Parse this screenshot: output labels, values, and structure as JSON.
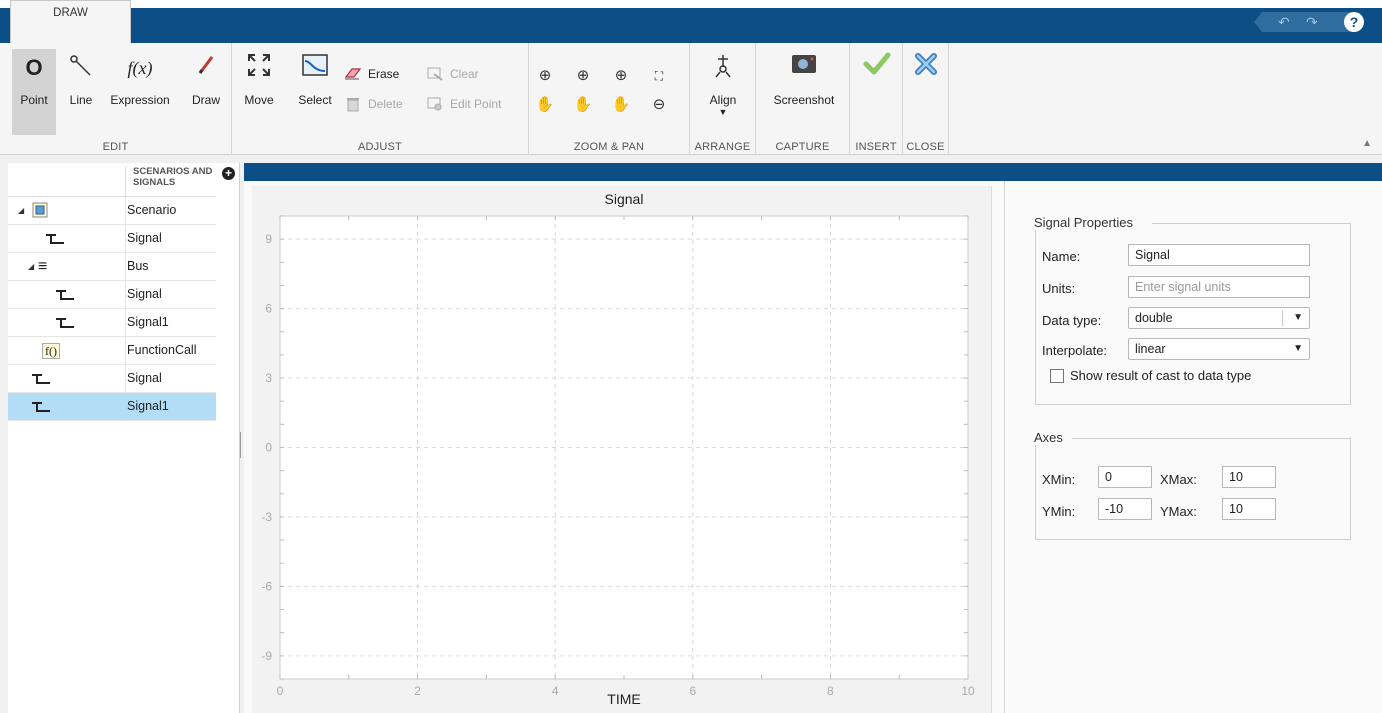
{
  "app": {
    "tab": "DRAW",
    "quick_access": {
      "undo": "undo-icon",
      "redo": "redo-icon",
      "help": "?"
    }
  },
  "toolstrip": {
    "edit": {
      "label": "EDIT",
      "point": "Point",
      "line": "Line",
      "expression": "Expression",
      "expression_glyph": "f(x)",
      "draw": "Draw"
    },
    "adjust": {
      "label": "ADJUST",
      "move": "Move",
      "select": "Select",
      "erase": "Erase",
      "clear": "Clear",
      "delete": "Delete",
      "edit_point": "Edit Point"
    },
    "zoom_pan": {
      "label": "ZOOM & PAN"
    },
    "arrange": {
      "label": "ARRANGE",
      "align": "Align"
    },
    "capture": {
      "label": "CAPTURE",
      "screenshot": "Screenshot"
    },
    "insert": {
      "label": "INSERT"
    },
    "close": {
      "label": "CLOSE"
    }
  },
  "tree": {
    "header": "SCENARIOS AND SIGNALS",
    "add_symbol": "+",
    "rows": [
      {
        "name": "Scenario",
        "type": "scenario",
        "level": 0,
        "expanded": true,
        "selected": false
      },
      {
        "name": "Signal",
        "type": "signal",
        "level": 1,
        "selected": false
      },
      {
        "name": "Bus",
        "type": "bus",
        "level": 1,
        "expanded": true,
        "selected": false
      },
      {
        "name": "Signal",
        "type": "signal",
        "level": 2,
        "selected": false
      },
      {
        "name": "Signal1",
        "type": "signal",
        "level": 2,
        "selected": false
      },
      {
        "name": "FunctionCall",
        "type": "function",
        "glyph": "f()",
        "level": 1,
        "selected": false
      },
      {
        "name": "Signal",
        "type": "signal",
        "level": 0,
        "selected": false
      },
      {
        "name": "Signal1",
        "type": "signal",
        "level": 0,
        "selected": true
      }
    ]
  },
  "chart_data": {
    "type": "line",
    "title": "Signal",
    "xlabel": "TIME",
    "ylabel": "",
    "xlim": [
      0,
      10
    ],
    "ylim": [
      -10,
      10
    ],
    "xticks": [
      0,
      2,
      4,
      6,
      8,
      10
    ],
    "yticks": [
      9,
      6,
      3,
      0,
      -3,
      -6,
      -9
    ],
    "grid": true,
    "series": []
  },
  "properties": {
    "title": "Signal Properties",
    "name_label": "Name:",
    "name_value": "Signal",
    "units_label": "Units:",
    "units_placeholder": "Enter signal units",
    "datatype_label": "Data type:",
    "datatype_value": "double",
    "interpolate_label": "Interpolate:",
    "interpolate_value": "linear",
    "show_cast_label": "Show result of cast to data type",
    "show_cast_checked": false
  },
  "axes": {
    "title": "Axes",
    "xmin_label": "XMin:",
    "xmin": "0",
    "xmax_label": "XMax:",
    "xmax": "10",
    "ymin_label": "YMin:",
    "ymin": "-10",
    "ymax_label": "YMax:",
    "ymax": "10"
  }
}
